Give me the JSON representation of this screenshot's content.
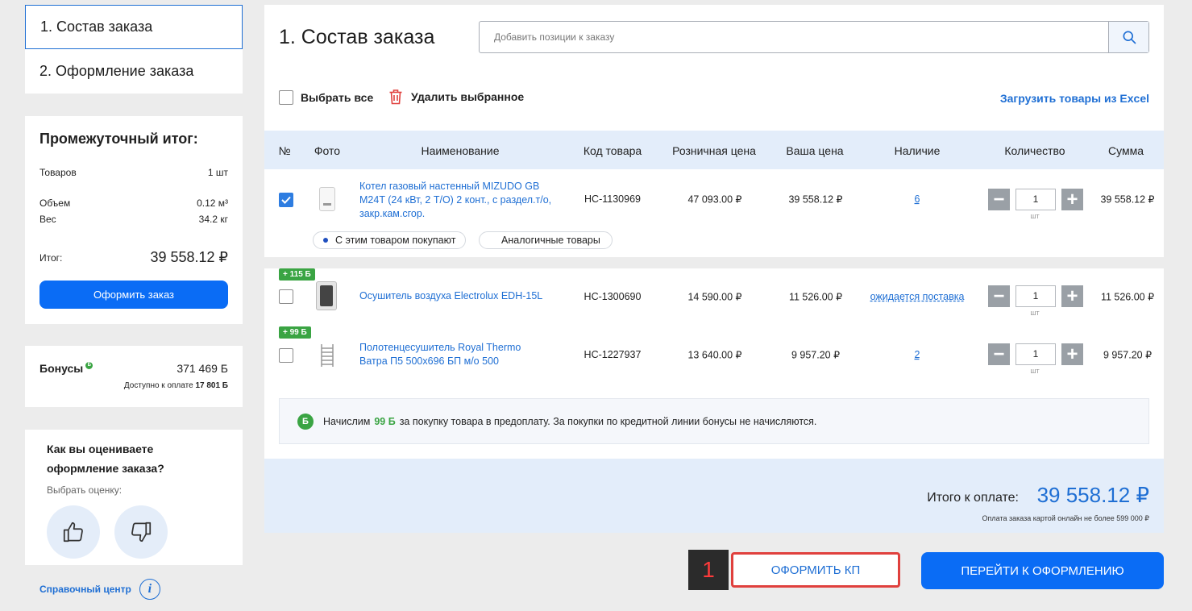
{
  "steps": [
    {
      "label": "1. Состав заказа",
      "active": true
    },
    {
      "label": "2. Оформление заказа",
      "active": false
    }
  ],
  "subtotal": {
    "title": "Промежуточный итог:",
    "goods_label": "Товаров",
    "goods_value": "1 шт",
    "volume_label": "Объем",
    "volume_value": "0.12 м³",
    "weight_label": "Вес",
    "weight_value": "34.2 кг",
    "total_label": "Итог:",
    "total_value": "39 558.12 ₽",
    "order_button": "Оформить заказ"
  },
  "bonuses": {
    "label": "Бонусы",
    "badge": "Б",
    "value": "371 469 Б",
    "available_label": "Доступно к оплате",
    "available_value": "17 801 Б"
  },
  "rating": {
    "question": "Как вы оцениваете оформление заказа?",
    "choose": "Выбрать оценку:"
  },
  "help": {
    "label": "Справочный центр",
    "icon": "i"
  },
  "main": {
    "title": "1. Состав заказа",
    "search_placeholder": "Добавить позиции к заказу",
    "select_all": "Выбрать все",
    "delete_selected": "Удалить выбранное",
    "excel_link": "Загрузить товары из Excel"
  },
  "table": {
    "headers": {
      "num": "№",
      "photo": "Фото",
      "name": "Наименование",
      "code": "Код товара",
      "retail": "Розничная цена",
      "price": "Ваша цена",
      "stock": "Наличие",
      "qty": "Количество",
      "sum": "Сумма"
    },
    "rows": [
      {
        "checked": true,
        "name": "Котел газовый настенный MIZUDO GB M24T (24 кВт, 2 Т/О) 2 конт., с раздел.т/о, закр.кам.сгор.",
        "code": "НС-1130969",
        "retail": "47 093.00 ₽",
        "price": "39 558.12 ₽",
        "stock": "6",
        "qty": "1",
        "unit": "шт",
        "sum": "39 558.12 ₽",
        "pill1": "С этим товаром покупают",
        "pill2": "Аналогичные товары"
      },
      {
        "checked": false,
        "bonus": "+ 115 Б",
        "name": "Осушитель воздуха Electrolux EDH-15L",
        "code": "НС-1300690",
        "retail": "14 590.00 ₽",
        "price": "11 526.00 ₽",
        "stock": "ожидается поставка",
        "qty": "1",
        "unit": "шт",
        "sum": "11 526.00 ₽"
      },
      {
        "checked": false,
        "bonus": "+ 99 Б",
        "name": "Полотенцесушитель Royal Thermo Ватра П5 500х696 БП м/о 500",
        "code": "НС-1227937",
        "retail": "13 640.00 ₽",
        "price": "9 957.20 ₽",
        "stock": "2",
        "qty": "1",
        "unit": "шт",
        "sum": "9 957.20 ₽"
      }
    ]
  },
  "notice": {
    "badge": "Б",
    "before": "Начислим",
    "amount": "99 Б",
    "after": "за покупку товара в предоплату. За покупки по кредитной линии бонусы не начисляются."
  },
  "total": {
    "label": "Итого к оплате:",
    "amount": "39 558.12 ₽",
    "note": "Оплата заказа картой онлайн не более 599 000 ₽"
  },
  "buttons": {
    "marker": "1",
    "kp": "ОФОРМИТЬ КП",
    "checkout": "ПЕРЕЙТИ К ОФОРМЛЕНИЮ"
  },
  "colors": {
    "accent": "#1f6fd4",
    "primary_button": "#0a6cf5",
    "bonus_green": "#3aa443",
    "highlight_red": "#e0403d"
  }
}
